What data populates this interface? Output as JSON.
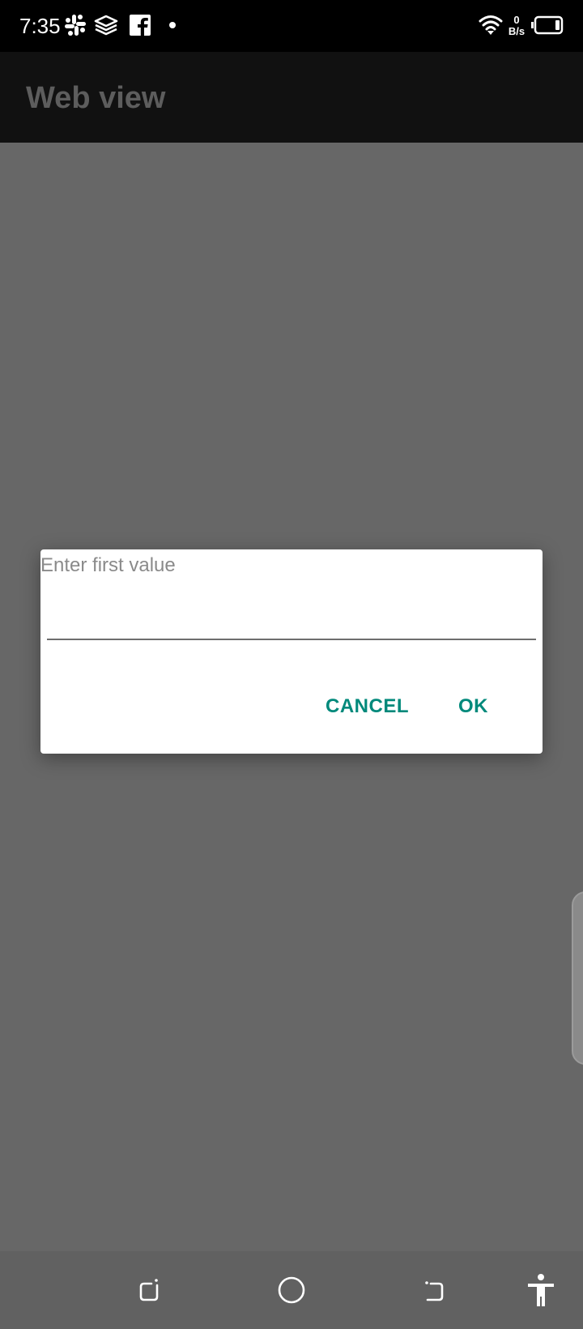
{
  "status_bar": {
    "time": "7:35",
    "netspeed_value": "0",
    "netspeed_unit": "B/s",
    "icons": [
      "slack-icon",
      "layers-icon",
      "facebook-icon",
      "notification-dot-icon",
      "wifi-icon",
      "battery-icon"
    ]
  },
  "app_bar": {
    "title": "Web view"
  },
  "dialog": {
    "input_placeholder": "Enter first value",
    "input_value": "",
    "cancel_label": "CANCEL",
    "ok_label": "OK",
    "accent_color": "#00897b"
  },
  "nav_bar": {
    "buttons": [
      "recent-apps-icon",
      "home-icon",
      "back-icon",
      "accessibility-icon"
    ]
  },
  "colors": {
    "scrim": "#676767",
    "status_bar": "#000000",
    "app_bar": "#111111",
    "dialog_background": "#ffffff",
    "nav_bar": "#616161"
  }
}
